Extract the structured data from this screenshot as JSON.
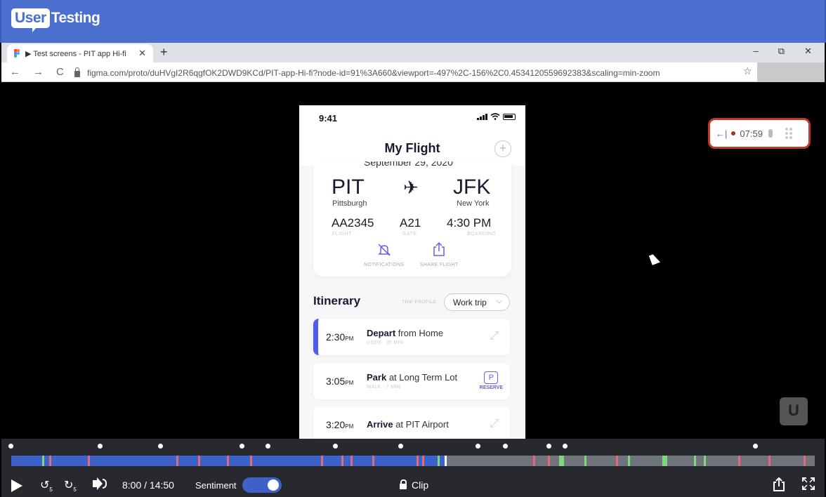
{
  "usertesting": {
    "logo_user": "User",
    "logo_testing": "Testing"
  },
  "browser": {
    "tab_title": "▶ Test screens - PIT app Hi-fi",
    "tab_close": "✕",
    "new_tab": "+",
    "url": "figma.com/proto/duHVgI2R6qgfOK2DWD9KCd/PIT-app-Hi-fi?node-id=91%3A660&viewport=-497%2C-156%2C0.4534120559692383&scaling=min-zoom",
    "window_controls": [
      "–",
      "⧉",
      "✕"
    ],
    "nav": {
      "back": "←",
      "forward": "→",
      "reload": "C"
    },
    "star": "☆"
  },
  "phone": {
    "status_time": "9:41",
    "app_title": "My Flight",
    "add_icon": "+",
    "date_partial": "September 29, 2020",
    "origin_code": "PIT",
    "origin_city": "Pittsburgh",
    "dest_code": "JFK",
    "dest_city": "New York",
    "plane_icon": "✈",
    "flight": {
      "value": "AA2345",
      "label": "FLIGHT"
    },
    "gate": {
      "value": "A21",
      "label": "GATE"
    },
    "boarding": {
      "value": "4:30 PM",
      "label": "BOARDING"
    },
    "actions": [
      {
        "icon": "bell-off-icon",
        "glyph": "🔕",
        "label": "NOTIFICATIONS"
      },
      {
        "icon": "share-icon",
        "glyph": "⇪",
        "label": "SHARE FLIGHT"
      }
    ],
    "itinerary_title": "Itinerary",
    "trip_profile_label": "TRIP PROFILE",
    "trip_profile_value": "Work trip",
    "trip_chevron": "⌵",
    "itinerary": [
      {
        "time": "2:30",
        "ampm": "PM",
        "verb": "Depart",
        "rest": " from Home",
        "sub": "USER · 35 MIN",
        "right": "⤢"
      },
      {
        "time": "3:05",
        "ampm": "PM",
        "verb": "Park",
        "rest": " at Long Term Lot",
        "sub": "WALK · 7 MIN",
        "reserve_icon": "P",
        "reserve_label": "RESERVE"
      },
      {
        "time": "3:20",
        "ampm": "PM",
        "verb": "Arrive",
        "rest": " at PIT Airport",
        "sub": "",
        "right": "⤢"
      }
    ]
  },
  "recorder": {
    "arrow": "←|",
    "time": "07:59"
  },
  "watermark": "U",
  "player": {
    "current_time": "8:00",
    "separator": "/",
    "total_time": "14:50",
    "sentiment_label": "Sentiment",
    "sentiment_on": true,
    "clip_label": "Clip",
    "skip_back": "↺",
    "skip_back_sec": "5",
    "skip_fwd": "↻",
    "skip_fwd_sec": "5",
    "progress": 0.539,
    "colors": {
      "accent": "#3d61c9",
      "negative": "#e06c7a",
      "positive": "#7ed67e"
    }
  }
}
